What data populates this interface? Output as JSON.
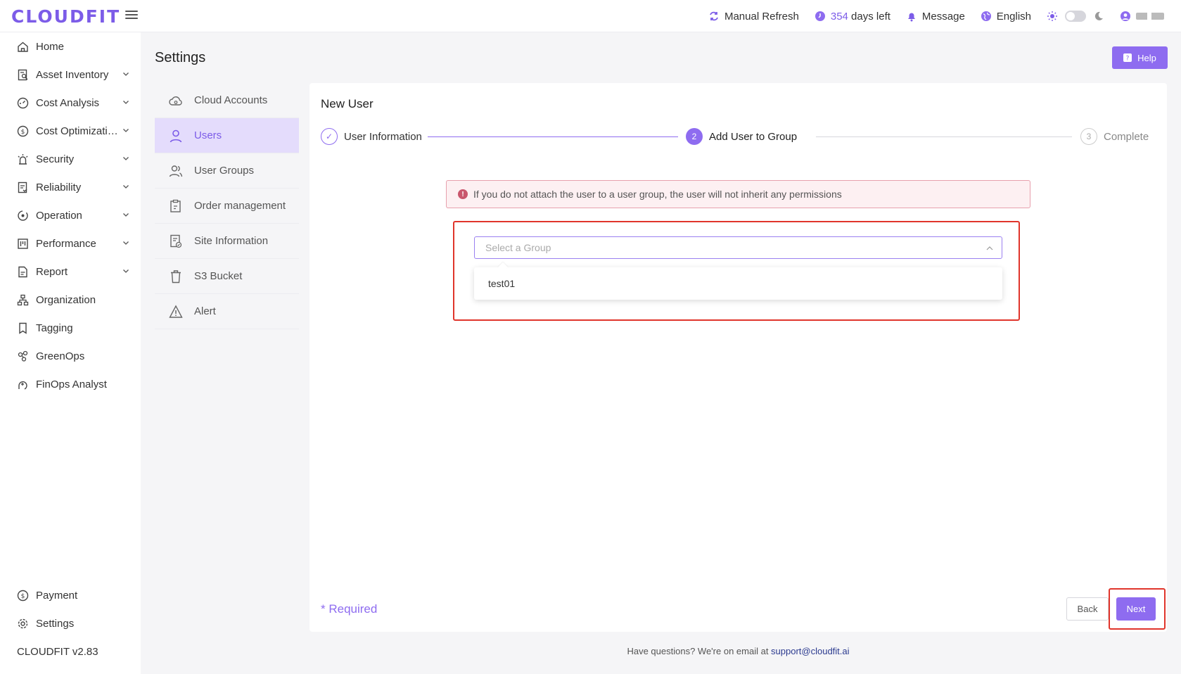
{
  "header": {
    "logo": "CLOUDFIT",
    "manual_refresh": "Manual Refresh",
    "days_count": "354",
    "days_suffix": " days left",
    "message": "Message",
    "language": "English"
  },
  "sidebar": {
    "items": [
      {
        "label": "Home",
        "icon": "home-icon",
        "expandable": false
      },
      {
        "label": "Asset Inventory",
        "icon": "asset-inventory-icon",
        "expandable": true
      },
      {
        "label": "Cost Analysis",
        "icon": "cost-analysis-icon",
        "expandable": true
      },
      {
        "label": "Cost Optimizati…",
        "icon": "cost-optimization-icon",
        "expandable": true
      },
      {
        "label": "Security",
        "icon": "security-icon",
        "expandable": true
      },
      {
        "label": "Reliability",
        "icon": "reliability-icon",
        "expandable": true
      },
      {
        "label": "Operation",
        "icon": "operation-icon",
        "expandable": true
      },
      {
        "label": "Performance",
        "icon": "performance-icon",
        "expandable": true
      },
      {
        "label": "Report",
        "icon": "report-icon",
        "expandable": true
      },
      {
        "label": "Organization",
        "icon": "organization-icon",
        "expandable": false
      },
      {
        "label": "Tagging",
        "icon": "tagging-icon",
        "expandable": false
      },
      {
        "label": "GreenOps",
        "icon": "greenops-icon",
        "expandable": false
      },
      {
        "label": "FinOps Analyst",
        "icon": "finops-analyst-icon",
        "expandable": false
      }
    ],
    "payment": "Payment",
    "settings": "Settings",
    "version": "CLOUDFIT v2.83"
  },
  "page": {
    "title": "Settings",
    "help": "Help"
  },
  "settings_menu": [
    {
      "label": "Cloud Accounts",
      "icon": "cloud-icon",
      "active": false
    },
    {
      "label": "Users",
      "icon": "user-icon",
      "active": true
    },
    {
      "label": "User Groups",
      "icon": "user-groups-icon",
      "active": false
    },
    {
      "label": "Order management",
      "icon": "order-icon",
      "active": false
    },
    {
      "label": "Site Information",
      "icon": "site-info-icon",
      "active": false
    },
    {
      "label": "S3 Bucket",
      "icon": "bucket-icon",
      "active": false
    },
    {
      "label": "Alert",
      "icon": "alert-icon",
      "active": false
    }
  ],
  "wizard": {
    "title": "New User",
    "steps": [
      {
        "label": "User Information",
        "marker": "✓",
        "status": "done"
      },
      {
        "label": "Add User to Group",
        "marker": "2",
        "status": "active"
      },
      {
        "label": "Complete",
        "marker": "3",
        "status": "wait"
      }
    ],
    "alert": "If you do not attach the user to a user group, the user will not inherit any permissions",
    "select_placeholder": "Select a Group",
    "options": [
      "test01"
    ],
    "required": "* Required",
    "back": "Back",
    "next": "Next"
  },
  "footer": {
    "text": "Have questions? We're on email at ",
    "email": "support@cloudfit.ai"
  },
  "colors": {
    "accent": "#8e6cf0",
    "highlight": "#e0352b"
  }
}
